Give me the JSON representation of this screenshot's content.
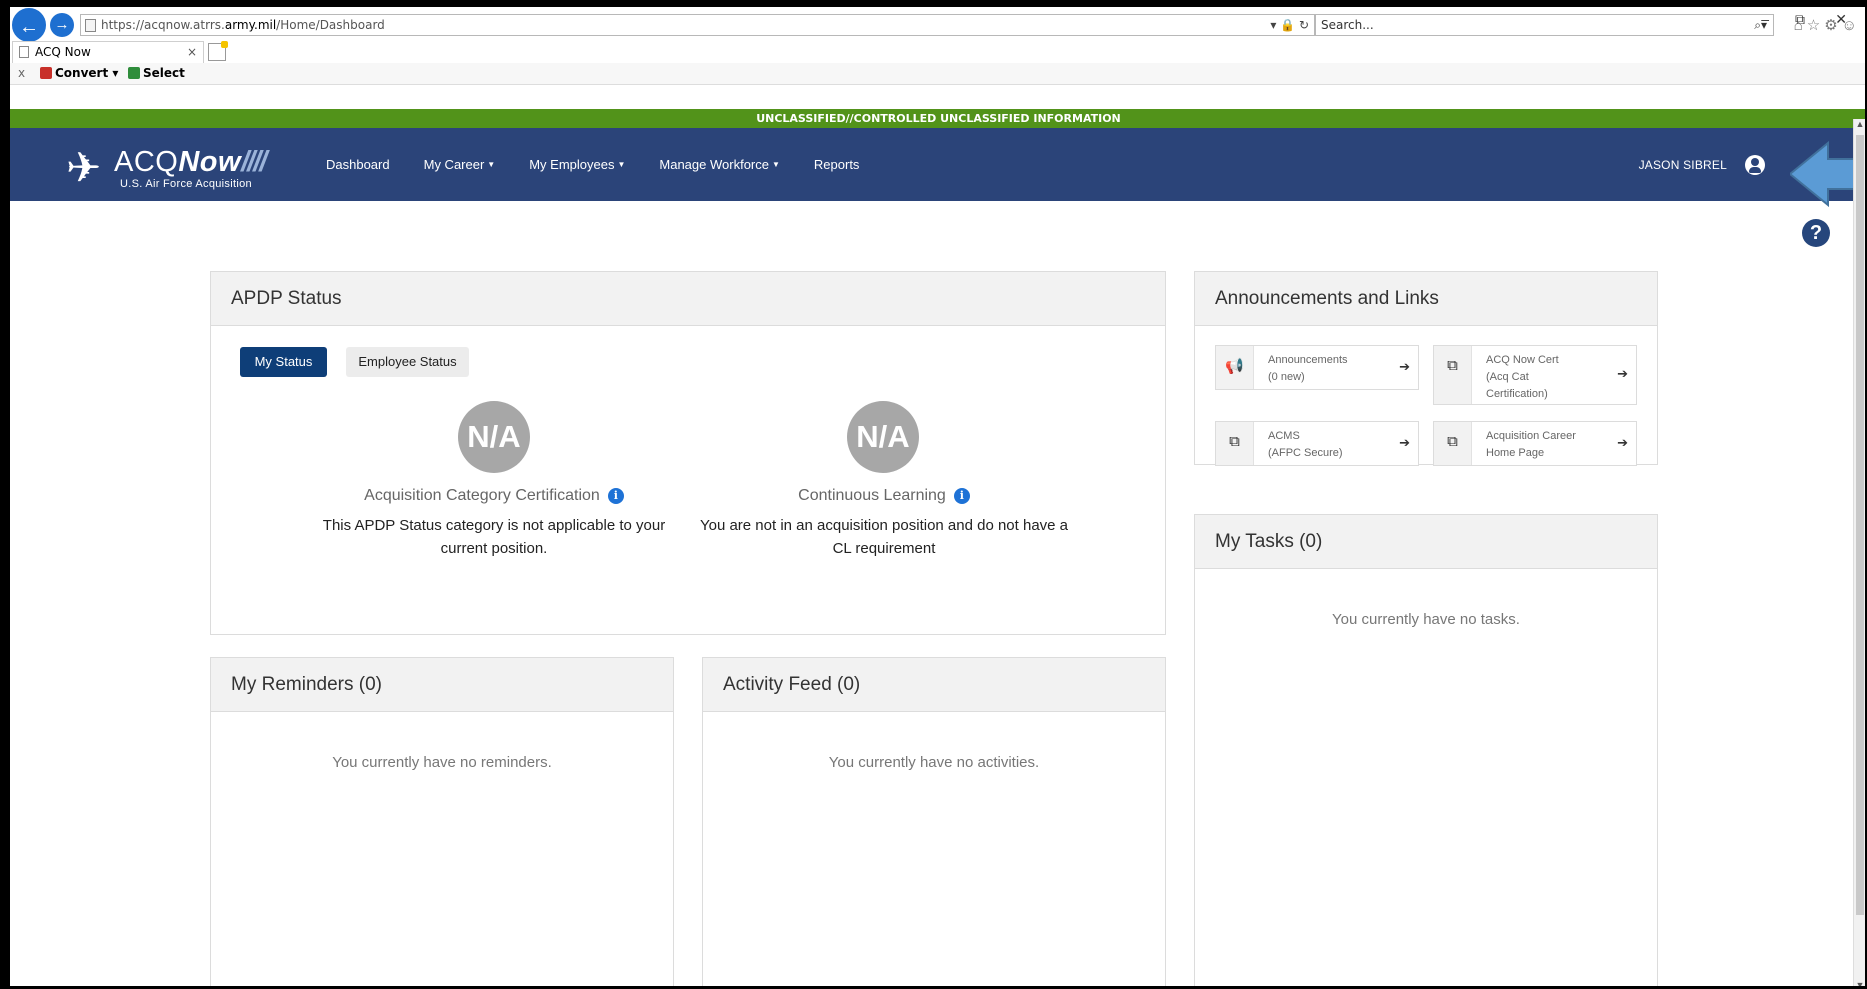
{
  "browser": {
    "url_prefix": "https://acqnow.atrrs.",
    "url_bold": "army.mil",
    "url_suffix": "/Home/Dashboard",
    "url_tools": "▾ 🔒 ↻",
    "search_placeholder": "Search...",
    "tab_title": "ACQ Now",
    "tab_close": "×",
    "win_minimize": "–",
    "win_restore": "⧉",
    "win_close": "✕",
    "toolbar_icons": "⌂☆⚙☺",
    "cmd_close": "x",
    "convert_label": "Convert",
    "select_label": "Select"
  },
  "classification": "UNCLASSIFIED//CONTROLLED UNCLASSIFIED INFORMATION",
  "logo": {
    "name_part1": "ACQ",
    "name_part2": "Now",
    "stripes": "////",
    "subtitle": "U.S. Air Force Acquisition"
  },
  "nav": {
    "items": [
      {
        "label": "Dashboard",
        "has_caret": false
      },
      {
        "label": "My Career",
        "has_caret": true
      },
      {
        "label": "My Employees",
        "has_caret": true
      },
      {
        "label": "Manage Workforce",
        "has_caret": true
      },
      {
        "label": "Reports",
        "has_caret": false
      }
    ],
    "user_name": "JASON SIBREL"
  },
  "apdp": {
    "title": "APDP Status",
    "my_status_btn": "My Status",
    "employee_status_btn": "Employee Status",
    "cards": [
      {
        "value": "N/A",
        "title": "Acquisition Category Certification",
        "description": "This APDP Status category is not applicable to your current position."
      },
      {
        "value": "N/A",
        "title": "Continuous Learning",
        "description": "You are not in an acquisition position and do not have a CL requirement"
      }
    ]
  },
  "announcements": {
    "title": "Announcements and Links",
    "links": [
      {
        "icon": "megaphone-icon",
        "text": "Announcements\n(0 new)"
      },
      {
        "icon": "external-link-icon",
        "text": "ACQ Now Cert\n(Acq Cat\nCertification)"
      },
      {
        "icon": "external-link-icon",
        "text": "ACMS\n(AFPC Secure)"
      },
      {
        "icon": "external-link-icon",
        "text": "Acquisition Career\nHome Page"
      }
    ]
  },
  "tasks": {
    "title": "My Tasks (0)",
    "empty": "You currently have no tasks."
  },
  "reminders": {
    "title": "My Reminders (0)",
    "empty": "You currently have no reminders."
  },
  "activity": {
    "title": "Activity Feed (0)",
    "empty": "You currently have no activities."
  },
  "colors": {
    "classification_bar": "#52931a",
    "navbar": "#2b4479",
    "primary_button": "#0e3e78",
    "info": "#1e72d6",
    "annotation_arrow": "#5b9bd5"
  }
}
